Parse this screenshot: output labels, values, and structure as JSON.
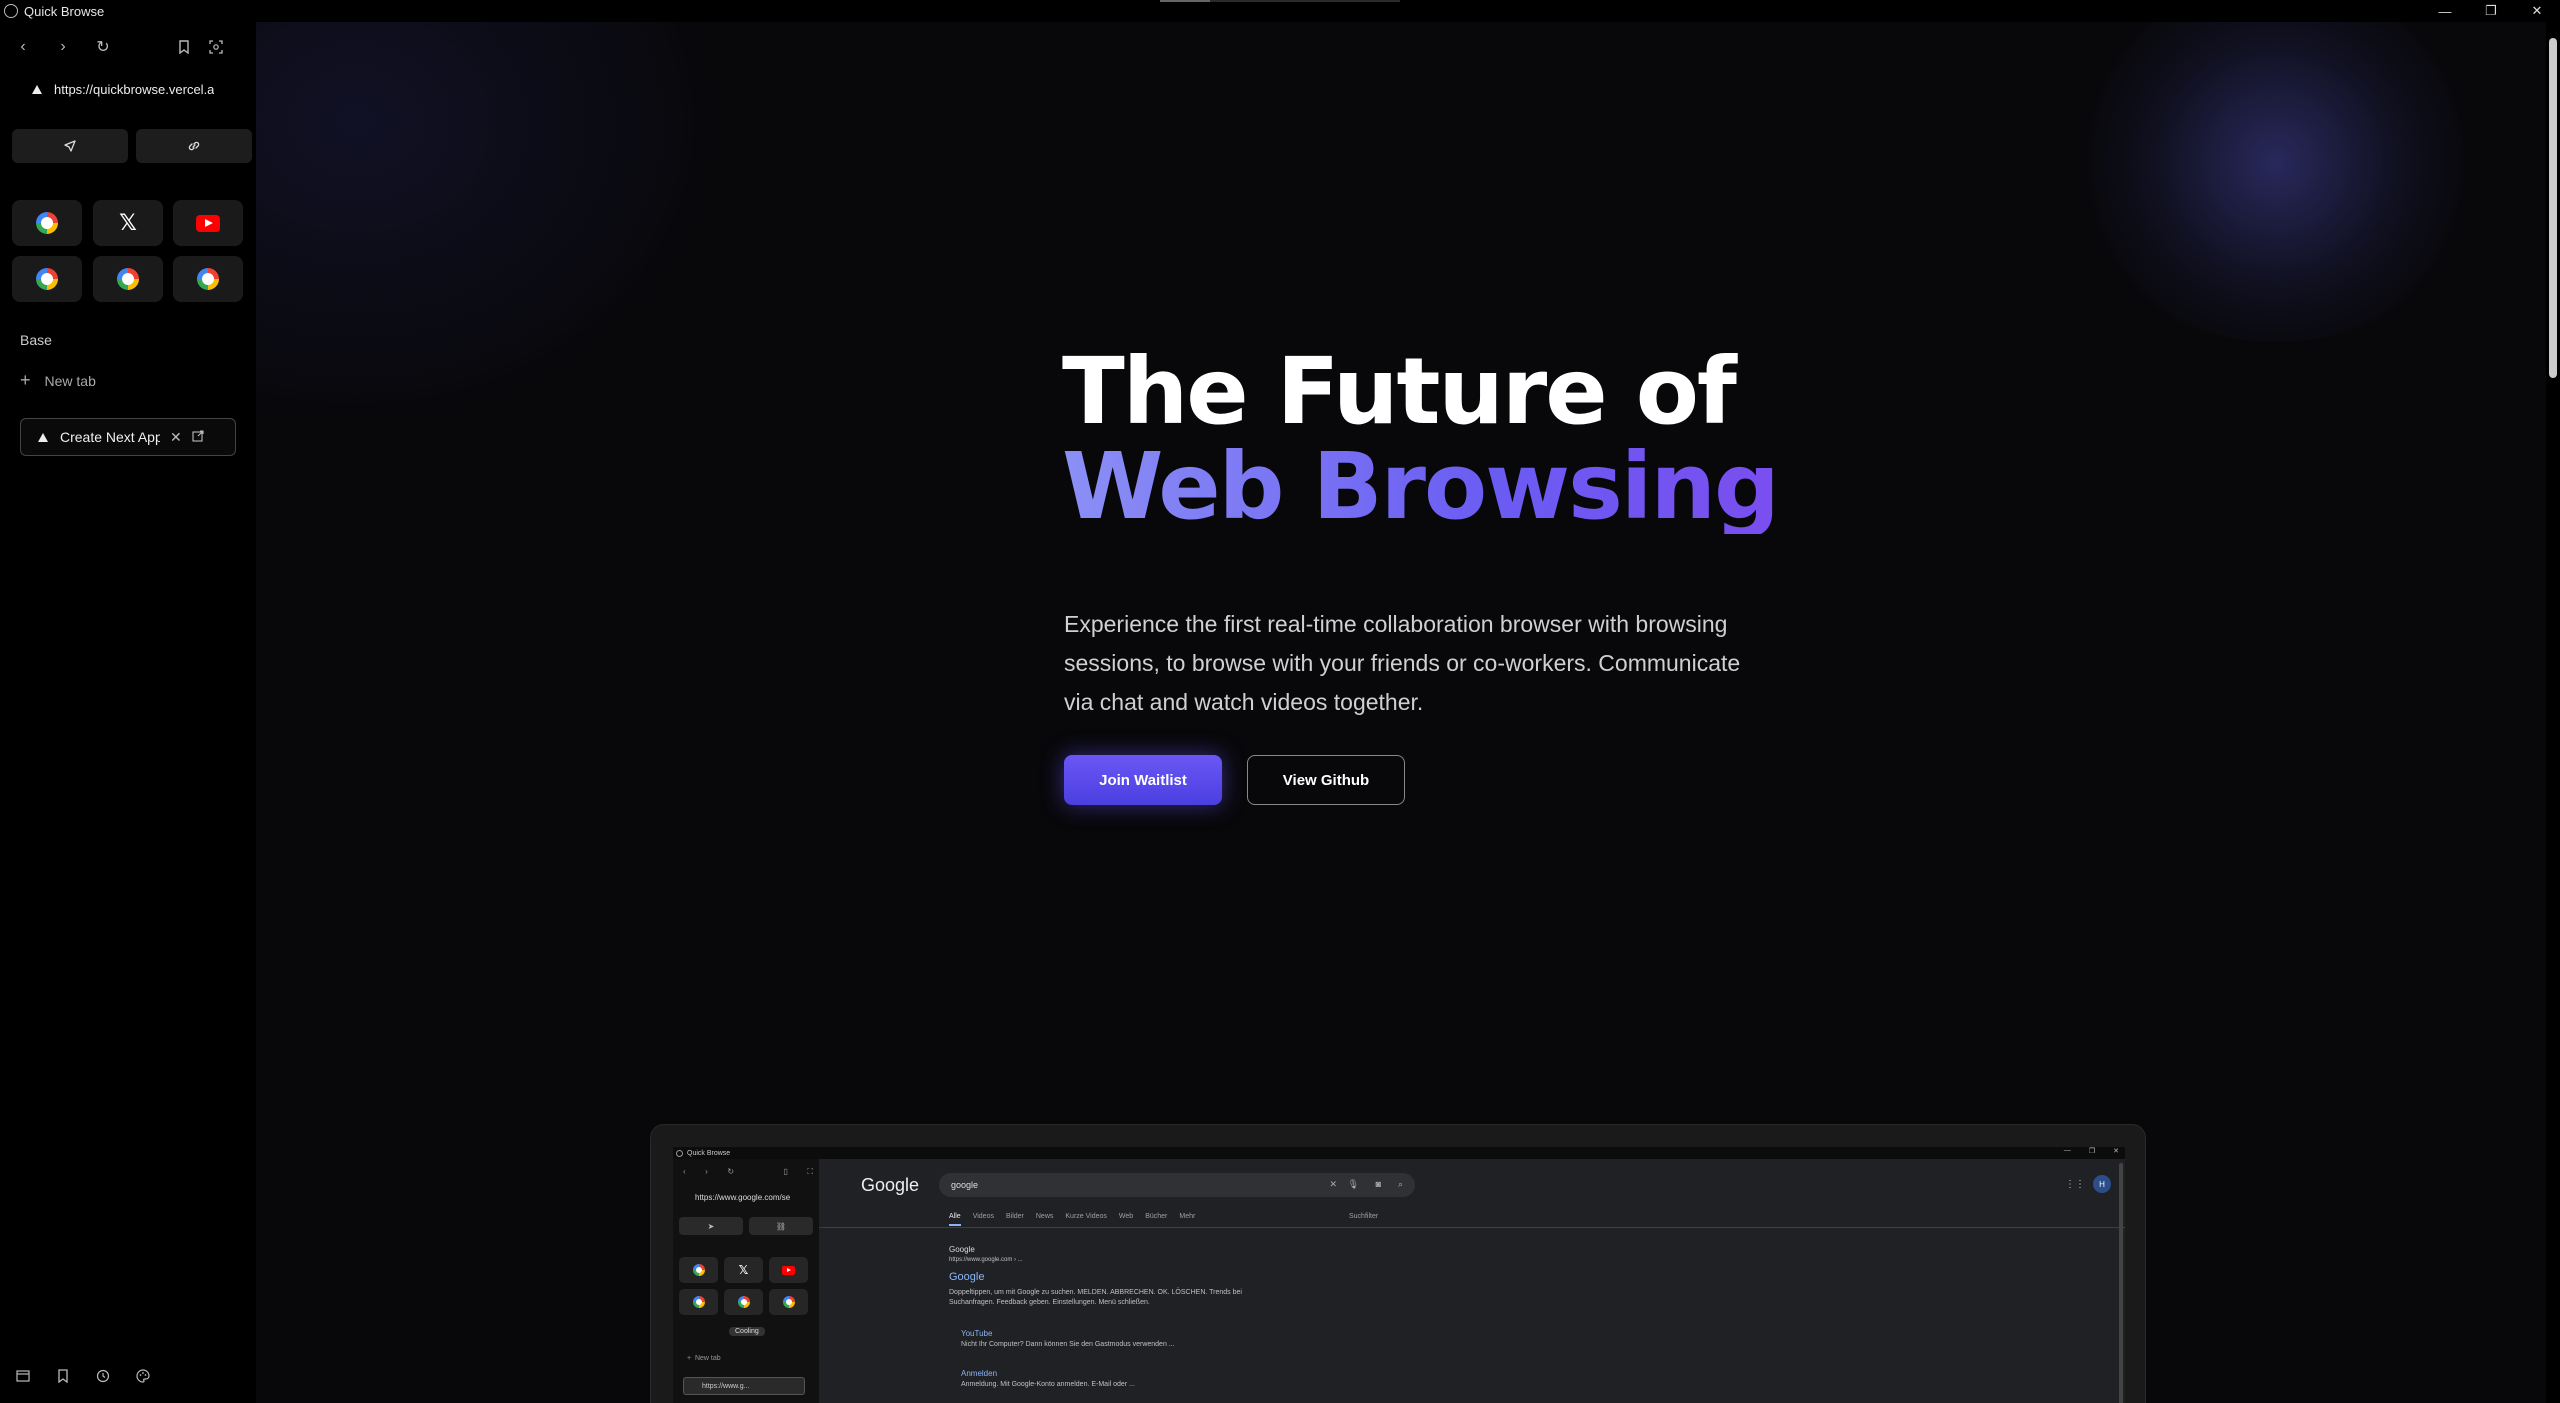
{
  "window": {
    "title": "Quick Browse",
    "controls": [
      "—",
      "❐",
      "✕"
    ]
  },
  "sidebar": {
    "url": "https://quickbrowse.vercel.app",
    "section_label": "Base",
    "new_tab_label": "New tab",
    "tab": {
      "title": "Create Next App"
    },
    "favorites": [
      "google-icon",
      "x-icon",
      "youtube-icon",
      "google-icon",
      "google-icon",
      "google-icon"
    ]
  },
  "hero": {
    "title_line1": "The Future of",
    "title_line2": "Web Browsing",
    "description": "Experience the first real-time collaboration browser with browsing sessions, to browse with your friends or co-workers. Communicate via chat and watch videos together.",
    "primary_button": "Join Waitlist",
    "secondary_button": "View Github",
    "accent_color": "#5b4ef0"
  },
  "preview": {
    "window_title": "Quick Browse",
    "url": "https://www.google.com/se",
    "session_badge": "Cooling",
    "new_tab_label": "New tab",
    "tab_title": "https://www.g...",
    "google_logo": "Google",
    "search_query": "google",
    "search_tabs": [
      "Alle",
      "Videos",
      "Bilder",
      "News",
      "Kurze Videos",
      "Web",
      "Bücher",
      "Mehr"
    ],
    "search_filter": "Suchfilter",
    "result_site": "Google",
    "result_site_url": "https://www.google.com › ...",
    "result_title": "Google",
    "result_snippet_1": "Doppeltippen, um mit Google zu suchen. MELDEN. ABBRECHEN. OK. LÖSCHEN. Trends bei",
    "result_snippet_2": "Suchanfragen. Feedback geben. Einstellungen. Menü schließen.",
    "sub1_title": "YouTube",
    "sub1_snippet": "Nicht Ihr Computer? Dann können Sie den Gastmodus verwenden ...",
    "sub2_title": "Anmelden",
    "sub2_snippet": "Anmeldung. Mit Google-Konto anmelden. E-Mail oder ...",
    "avatar_letter": "H"
  }
}
